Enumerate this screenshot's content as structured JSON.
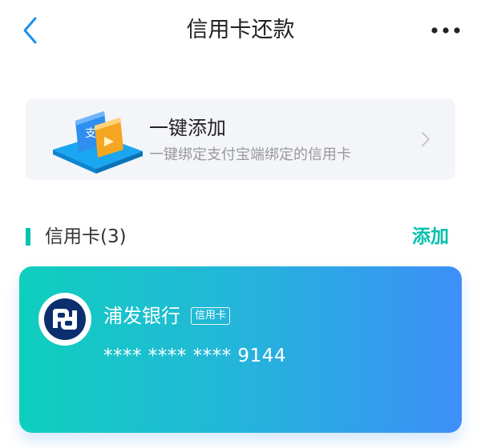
{
  "nav": {
    "title": "信用卡还款",
    "back_icon": "chevron-left-icon",
    "more_icon": "more-horizontal-icon",
    "accent_color": "#1f8fe8"
  },
  "quick_add": {
    "title": "一键添加",
    "description": "一键绑定支付宝端绑定的信用卡",
    "illustration": "card-bind-illustration",
    "chevron_icon": "chevron-right-icon"
  },
  "section": {
    "title": "信用卡(3)",
    "add_label": "添加",
    "accent_color": "#00bfae"
  },
  "cards": [
    {
      "bank_name": "浦发银行",
      "card_type": "信用卡",
      "number": "**** **** **** 9144",
      "logo_icon": "spdb-bank-logo-icon",
      "gradient_colors": [
        "#0fcfbd",
        "#3d8ff8"
      ]
    }
  ]
}
